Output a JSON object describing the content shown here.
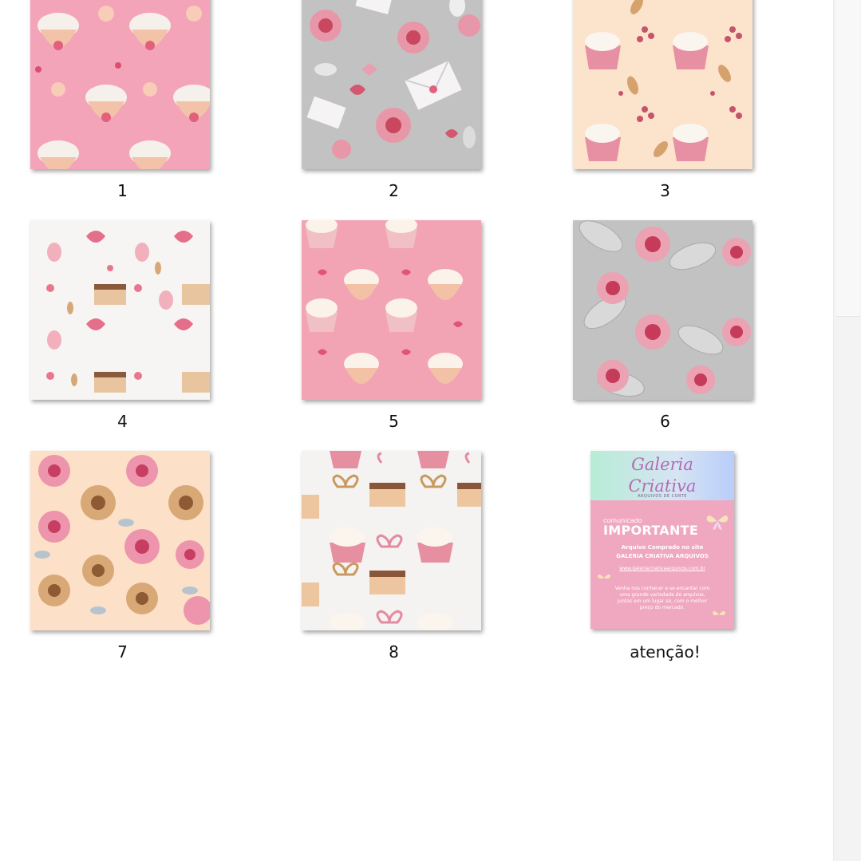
{
  "files": [
    {
      "label": "1",
      "pattern": "pink-cupcakes",
      "background": "#f3a4b8"
    },
    {
      "label": "2",
      "pattern": "grey-roses-envelopes",
      "background": "#c2c2c2"
    },
    {
      "label": "3",
      "pattern": "peach-cupcakes-berries",
      "background": "#fbe3cc"
    },
    {
      "label": "4",
      "pattern": "white-hearts-cakes",
      "background": "#f7f5f3"
    },
    {
      "label": "5",
      "pattern": "pink-cupcakes-mugs",
      "background": "#f2a4b5"
    },
    {
      "label": "6",
      "pattern": "grey-roses",
      "background": "#c2c2c2"
    },
    {
      "label": "7",
      "pattern": "peach-roses",
      "background": "#fde0c8"
    },
    {
      "label": "8",
      "pattern": "white-cupcakes-cakes",
      "background": "#f5f3f2"
    }
  ],
  "notice": {
    "label": "atenção!",
    "brand_line1": "Galeria",
    "brand_line2": "Criativa",
    "brand_sub": "ARQUIVOS DE CORTE",
    "small_text": "comunicado",
    "title": "IMPORTANTE",
    "line1": "Arquivo Comprado no site",
    "line2": "GALERIA CRIATIVA ARQUIVOS",
    "url": "www.galeriacriativaarquivos.com.br",
    "body1": "Venha nos conhecer e se encantar com",
    "body2": "uma grande variedade de arquivos,",
    "body3": "juntos em um lugar só, com o melhor",
    "body4": "preço do mercado."
  }
}
